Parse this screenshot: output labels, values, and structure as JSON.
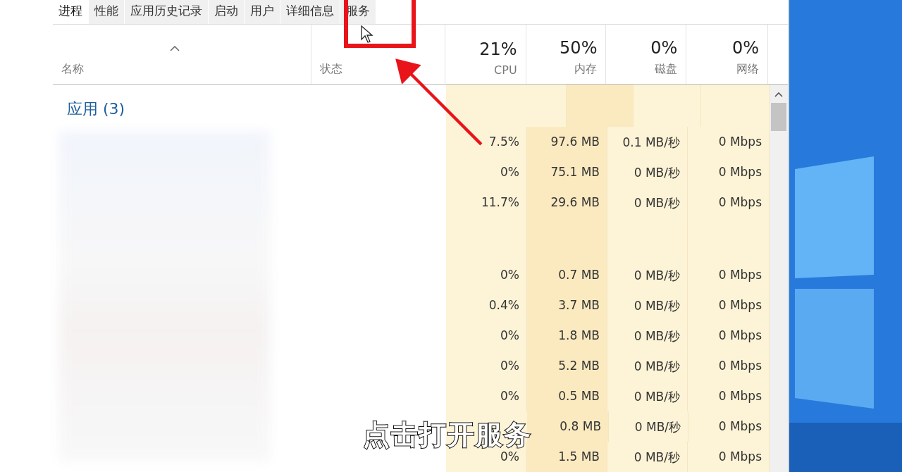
{
  "tabs": [
    {
      "label": "进程",
      "selected": true
    },
    {
      "label": "性能",
      "selected": false
    },
    {
      "label": "应用历史记录",
      "selected": false
    },
    {
      "label": "启动",
      "selected": false
    },
    {
      "label": "用户",
      "selected": false
    },
    {
      "label": "详细信息",
      "selected": false
    },
    {
      "label": "服务",
      "selected": false
    }
  ],
  "columns": [
    {
      "label": "名称"
    },
    {
      "label": "状态"
    },
    {
      "label": "CPU",
      "usage": "21%"
    },
    {
      "label": "内存",
      "usage": "50%"
    },
    {
      "label": "磁盘",
      "usage": "0%"
    },
    {
      "label": "网络",
      "usage": "0%"
    }
  ],
  "group": {
    "title": "应用 (3)"
  },
  "rows": [
    {
      "kind": "process",
      "cells": [
        "7.5%",
        "97.6 MB",
        "0.1 MB/秒",
        "0 Mbps"
      ]
    },
    {
      "kind": "process",
      "cells": [
        "0%",
        "75.1 MB",
        "0 MB/秒",
        "0 Mbps"
      ]
    },
    {
      "kind": "process",
      "cells": [
        "11.7%",
        "29.6 MB",
        "0 MB/秒",
        "0 Mbps"
      ]
    },
    {
      "kind": "gap"
    },
    {
      "kind": "process",
      "cells": [
        "0%",
        "0.7 MB",
        "0 MB/秒",
        "0 Mbps"
      ]
    },
    {
      "kind": "process",
      "cells": [
        "0.4%",
        "3.7 MB",
        "0 MB/秒",
        "0 Mbps"
      ]
    },
    {
      "kind": "process",
      "cells": [
        "0%",
        "1.8 MB",
        "0 MB/秒",
        "0 Mbps"
      ]
    },
    {
      "kind": "process",
      "cells": [
        "0%",
        "5.2 MB",
        "0 MB/秒",
        "0 Mbps"
      ]
    },
    {
      "kind": "process",
      "cells": [
        "0%",
        "0.5 MB",
        "0 MB/秒",
        "0 Mbps"
      ]
    },
    {
      "kind": "process",
      "cells": [
        null,
        "0.8 MB",
        "0 MB/秒",
        "0 Mbps"
      ]
    },
    {
      "kind": "process",
      "cells": [
        "0%",
        "1.5 MB",
        "0 MB/秒",
        "0 Mbps"
      ]
    }
  ],
  "caption": "点击打开服务"
}
